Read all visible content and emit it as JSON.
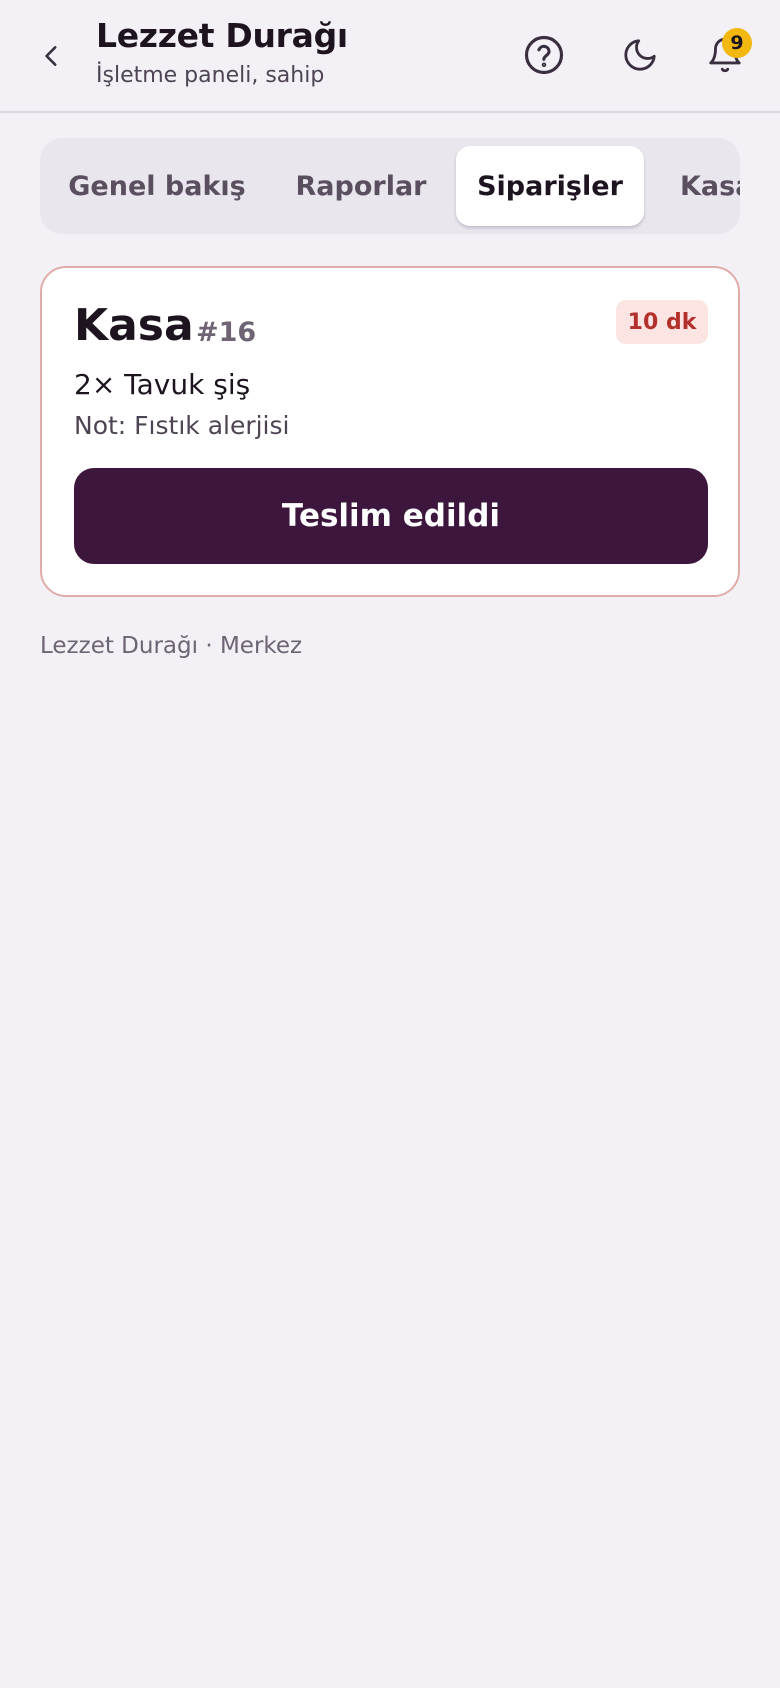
{
  "header": {
    "title": "Lezzet Durağı",
    "subtitle": "İşletme paneli, sahip",
    "back_icon": "chevron-left-icon",
    "help_icon": "help-circle-icon",
    "theme_icon": "moon-icon",
    "bell_icon": "bell-icon",
    "notification_count": "9"
  },
  "tabs": [
    {
      "label": "Genel bakış",
      "active": false
    },
    {
      "label": "Raporlar",
      "active": false
    },
    {
      "label": "Siparişler",
      "active": true
    },
    {
      "label": "Kasa",
      "active": false
    }
  ],
  "order": {
    "title": "Kasa",
    "number": "#16",
    "time": "10 dk",
    "item": "2× Tavuk şiş",
    "note": "Not: Fıstık alerjisi",
    "action_label": "Teslim edildi"
  },
  "footer": {
    "text": "Lezzet Durağı · Merkez"
  },
  "colors": {
    "background": "#f3f1f6",
    "primary": "#3c163d",
    "badge": "#f2b80f",
    "urgent_text": "#b4302c",
    "urgent_bg": "#fbe4e2",
    "card_border": "#e0aca9"
  }
}
